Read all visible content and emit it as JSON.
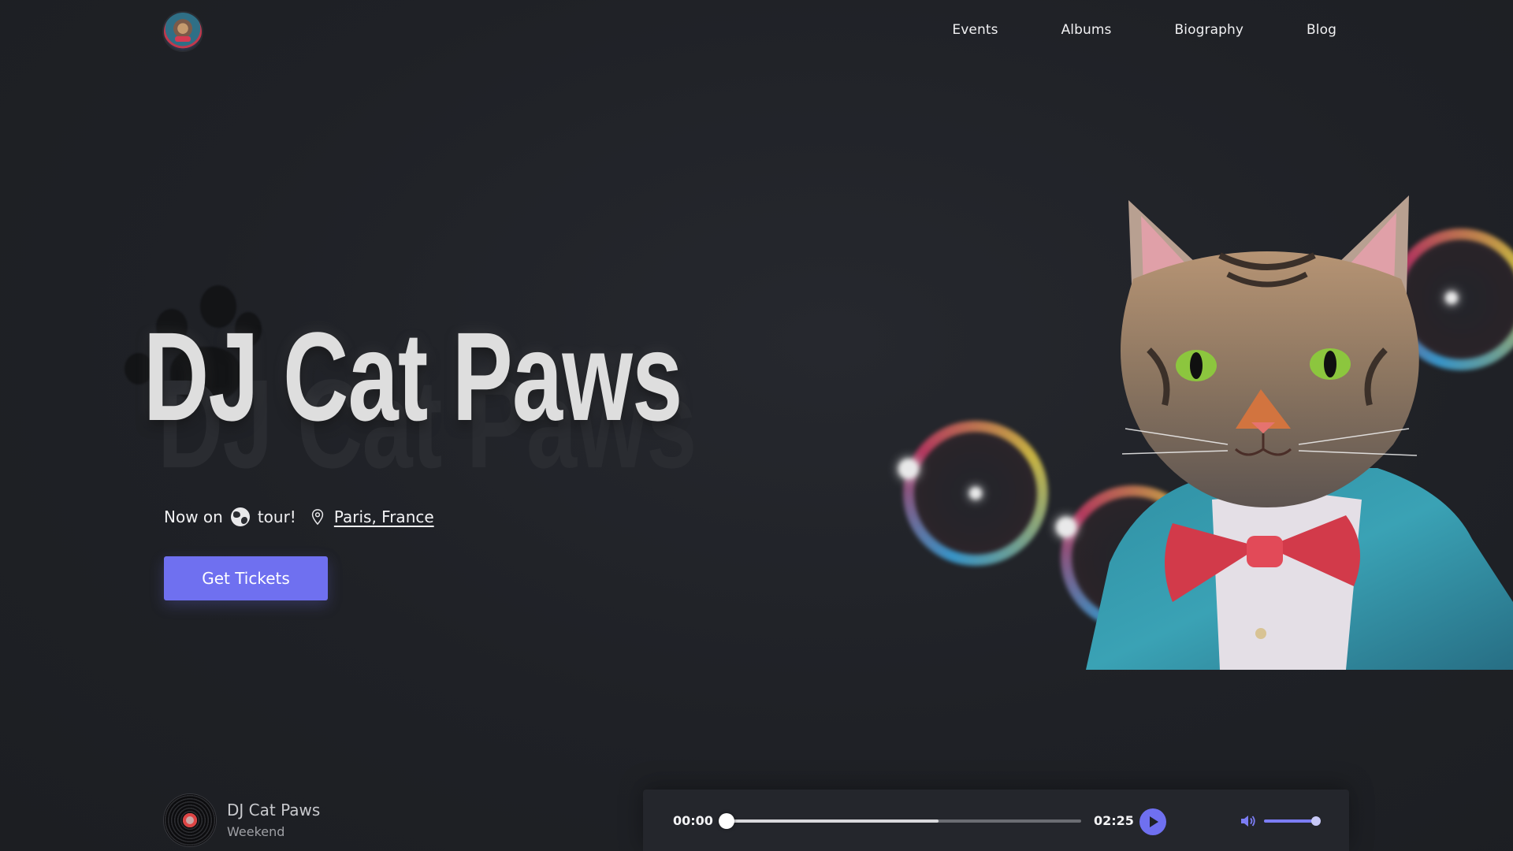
{
  "header": {
    "logo_alt": "DJ Cat Paws logo",
    "nav": [
      "Events",
      "Albums",
      "Biography",
      "Blog"
    ]
  },
  "hero": {
    "title": "DJ Cat Paws",
    "tour_prefix": "Now on",
    "tour_suffix": "tour!",
    "location": "Paris, France",
    "cta_label": "Get Tickets"
  },
  "player": {
    "artist": "DJ Cat Paws",
    "track": "Weekend",
    "current_time": "00:00",
    "duration": "02:25",
    "progress": 0,
    "buffered": 0.6,
    "volume": 1.0
  },
  "colors": {
    "accent": "#6f70f0",
    "background": "#1f2126"
  },
  "icons": [
    "globe-icon",
    "map-pin-icon",
    "play-icon",
    "volume-icon"
  ]
}
